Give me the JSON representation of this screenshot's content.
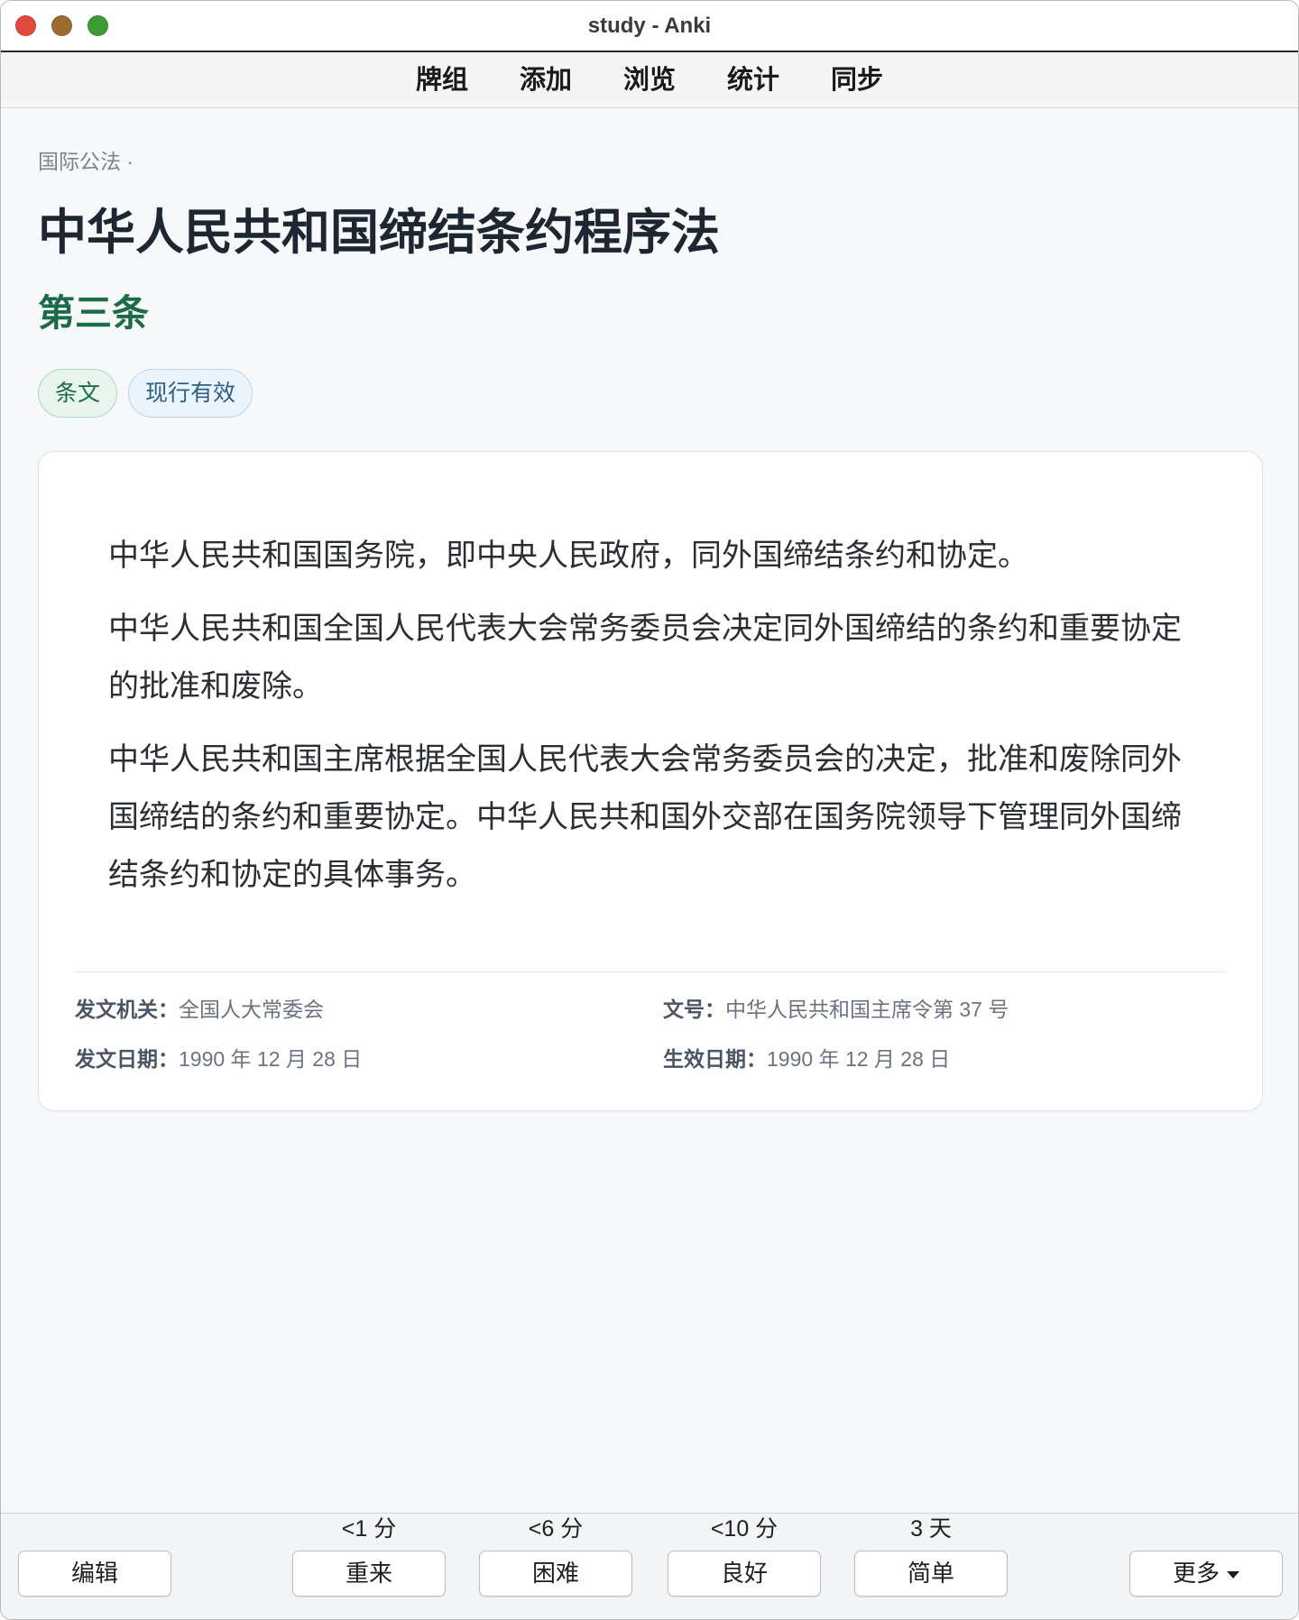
{
  "window": {
    "title": "study - Anki"
  },
  "toolbar": {
    "items": [
      "牌组",
      "添加",
      "浏览",
      "统计",
      "同步"
    ]
  },
  "note": {
    "breadcrumb": "国际公法 ·",
    "title": "中华人民共和国缔结条约程序法",
    "article": "第三条",
    "tags": [
      "条文",
      "现行有效"
    ],
    "paragraphs": [
      "中华人民共和国国务院，即中央人民政府，同外国缔结条约和协定。",
      "中华人民共和国全国人民代表大会常务委员会决定同外国缔结的条约和重要协定的批准和废除。",
      "中华人民共和国主席根据全国人民代表大会常务委员会的决定，批准和废除同外国缔结的条约和重要协定。中华人民共和国外交部在国务院领导下管理同外国缔结条约和协定的具体事务。"
    ],
    "meta": [
      {
        "label": "发文机关：",
        "value": "全国人大常委会"
      },
      {
        "label": "文号：",
        "value": "中华人民共和国主席令第 37 号"
      },
      {
        "label": "发文日期：",
        "value": "1990 年 12 月 28 日"
      },
      {
        "label": "生效日期：",
        "value": "1990 年 12 月 28 日"
      }
    ]
  },
  "review_bar": {
    "edit_label": "编辑",
    "answers": [
      {
        "interval": "<1 分",
        "label": "重来"
      },
      {
        "interval": "<6 分",
        "label": "困难"
      },
      {
        "interval": "<10 分",
        "label": "良好"
      },
      {
        "interval": "3 天",
        "label": "简单"
      }
    ],
    "more_label": "更多",
    "more_icon": "caret-down-icon"
  },
  "colors": {
    "close": "#e5483c",
    "minimize": "#9c6b2f",
    "maximize": "#3a9c33",
    "accent": "#1b6b48",
    "heading": "#1d2731"
  }
}
